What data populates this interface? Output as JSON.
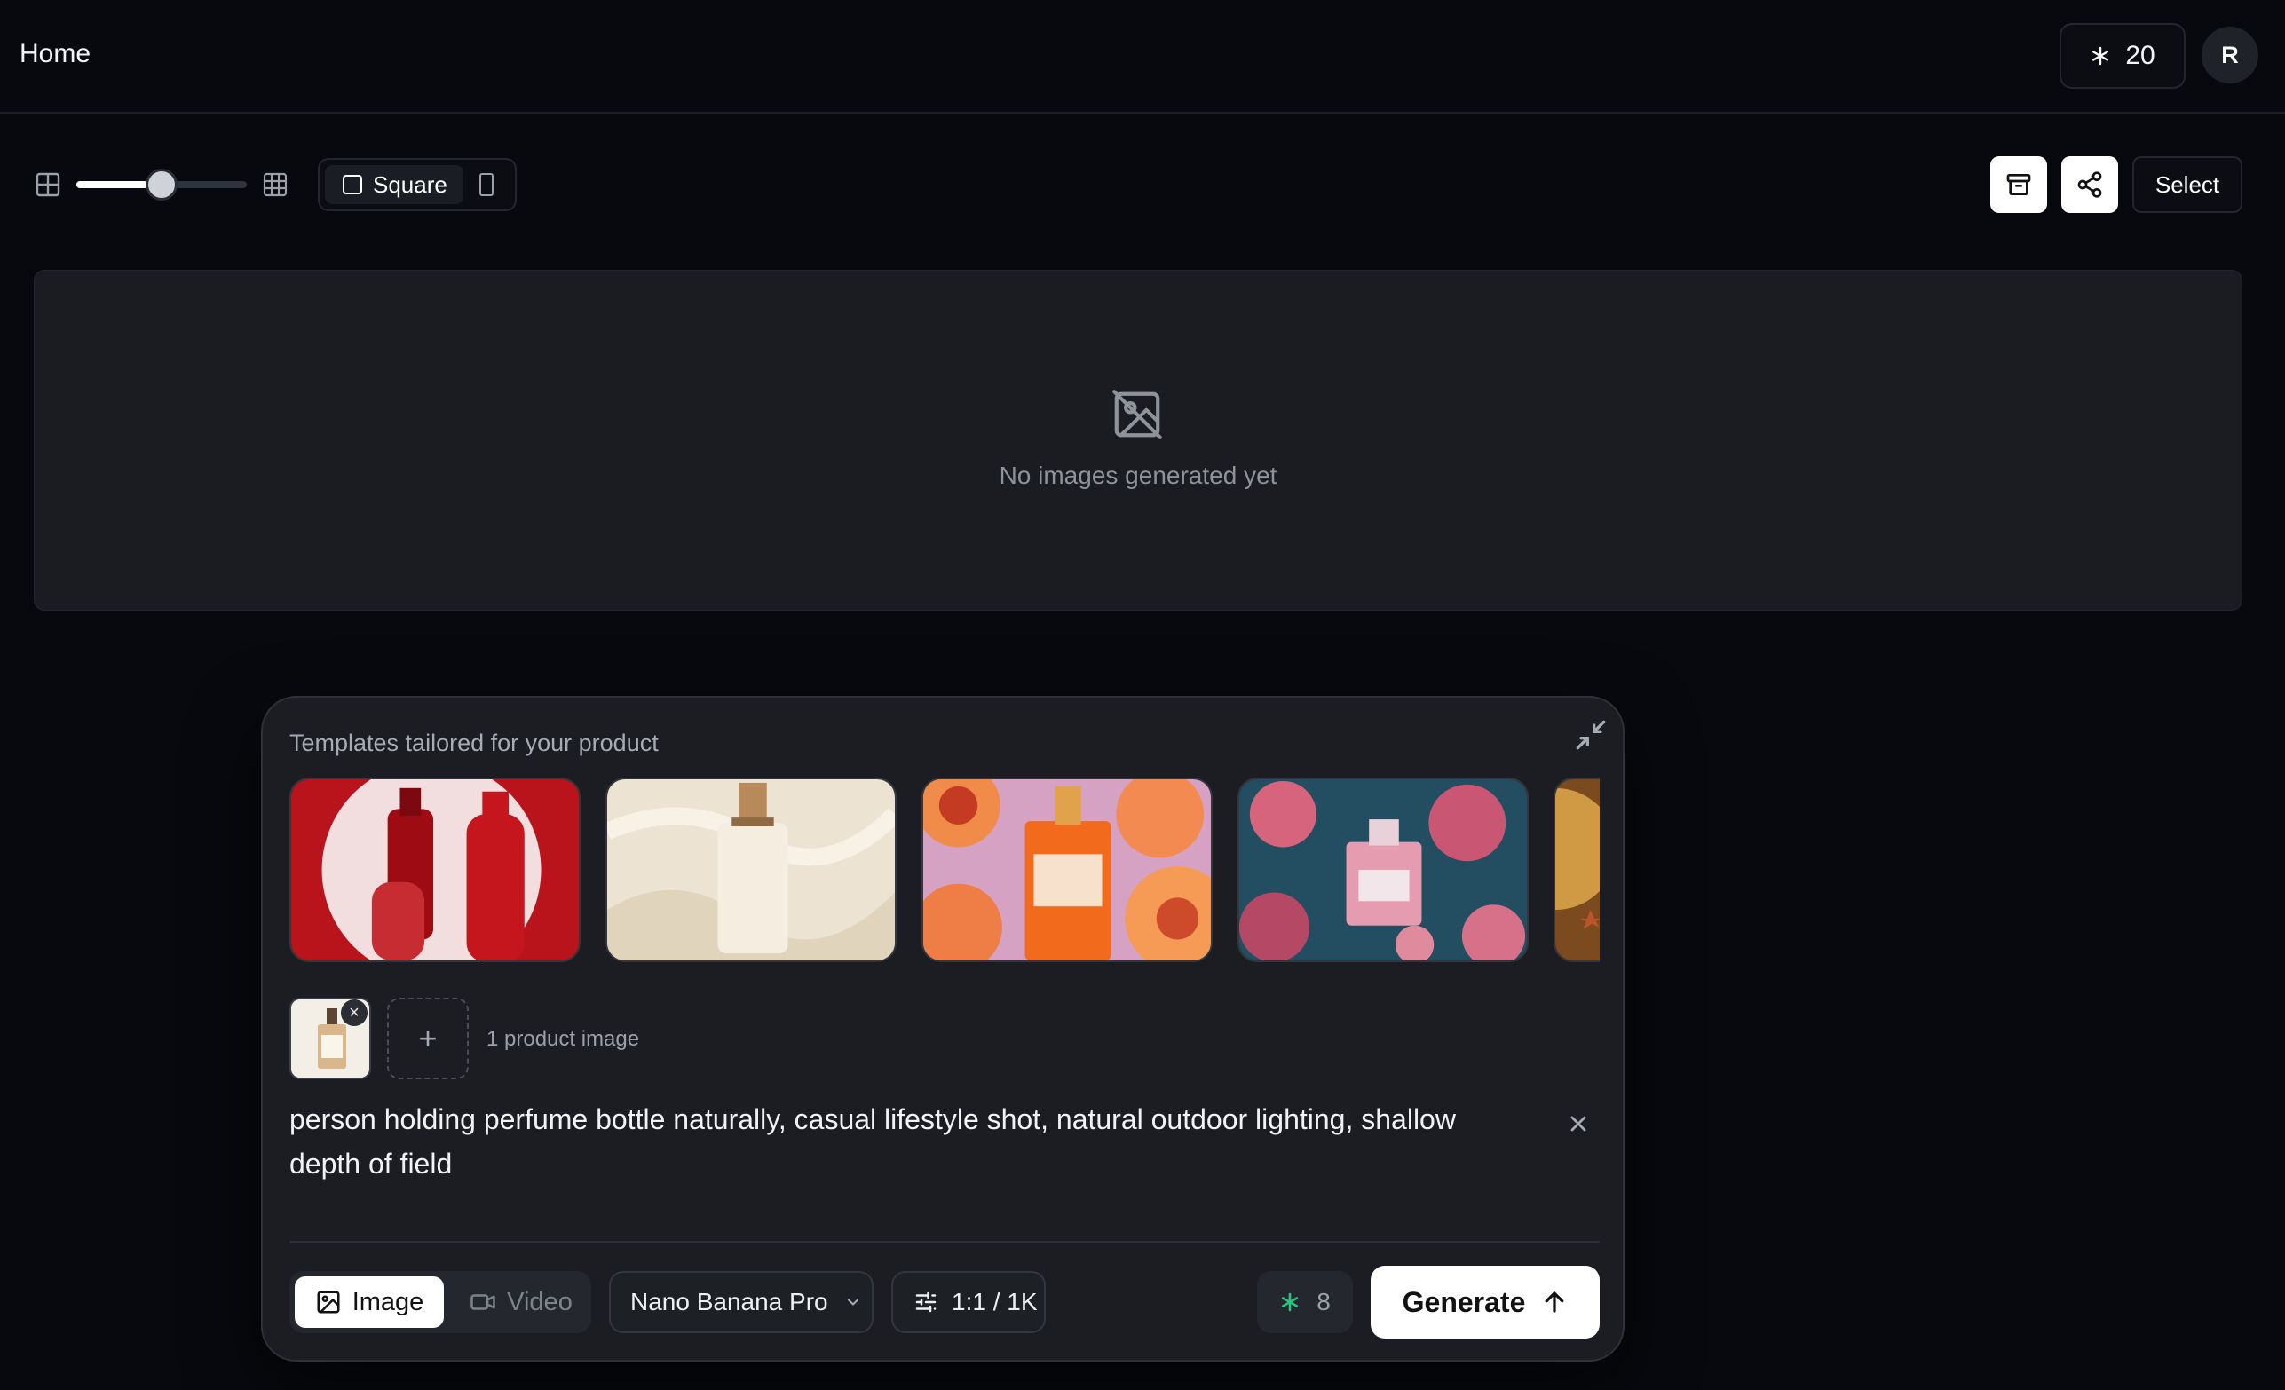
{
  "header": {
    "title": "Home",
    "credits": "20",
    "avatar_initial": "R"
  },
  "toolbar": {
    "grid_density_level": 0.5,
    "aspect_selected": "Square",
    "select_label": "Select",
    "icons": [
      "grid-small-icon",
      "grid-large-icon",
      "square-icon",
      "portrait-icon",
      "archive-icon",
      "share-icon"
    ]
  },
  "gallery": {
    "empty_text": "No images generated yet",
    "empty_icon": "image-off-icon"
  },
  "composer": {
    "templates_title": "Templates tailored for your product",
    "templates": [
      {
        "name": "red-nail-polish-bottle"
      },
      {
        "name": "vanilla-cream-bottle"
      },
      {
        "name": "tom-ford-bitter-peach"
      },
      {
        "name": "pink-perfume-underwater-flowers"
      },
      {
        "name": "golden-partial-template"
      }
    ],
    "product_count_label": "1 product image",
    "prompt_text": "person holding perfume bottle naturally, casual lifestyle shot, natural outdoor lighting, shallow depth of field",
    "mode": {
      "image_label": "Image",
      "video_label": "Video",
      "selected": "Image"
    },
    "model_label": "Nano Banana Pro",
    "ratio_label": "1:1 / 1K",
    "cost": "8",
    "generate_label": "Generate"
  },
  "colors": {
    "background": "#07090e",
    "panel": "#1a1c21",
    "composer": "#1b1d22",
    "accent_green": "#2ec27e",
    "primary_button": "#ffffff"
  }
}
